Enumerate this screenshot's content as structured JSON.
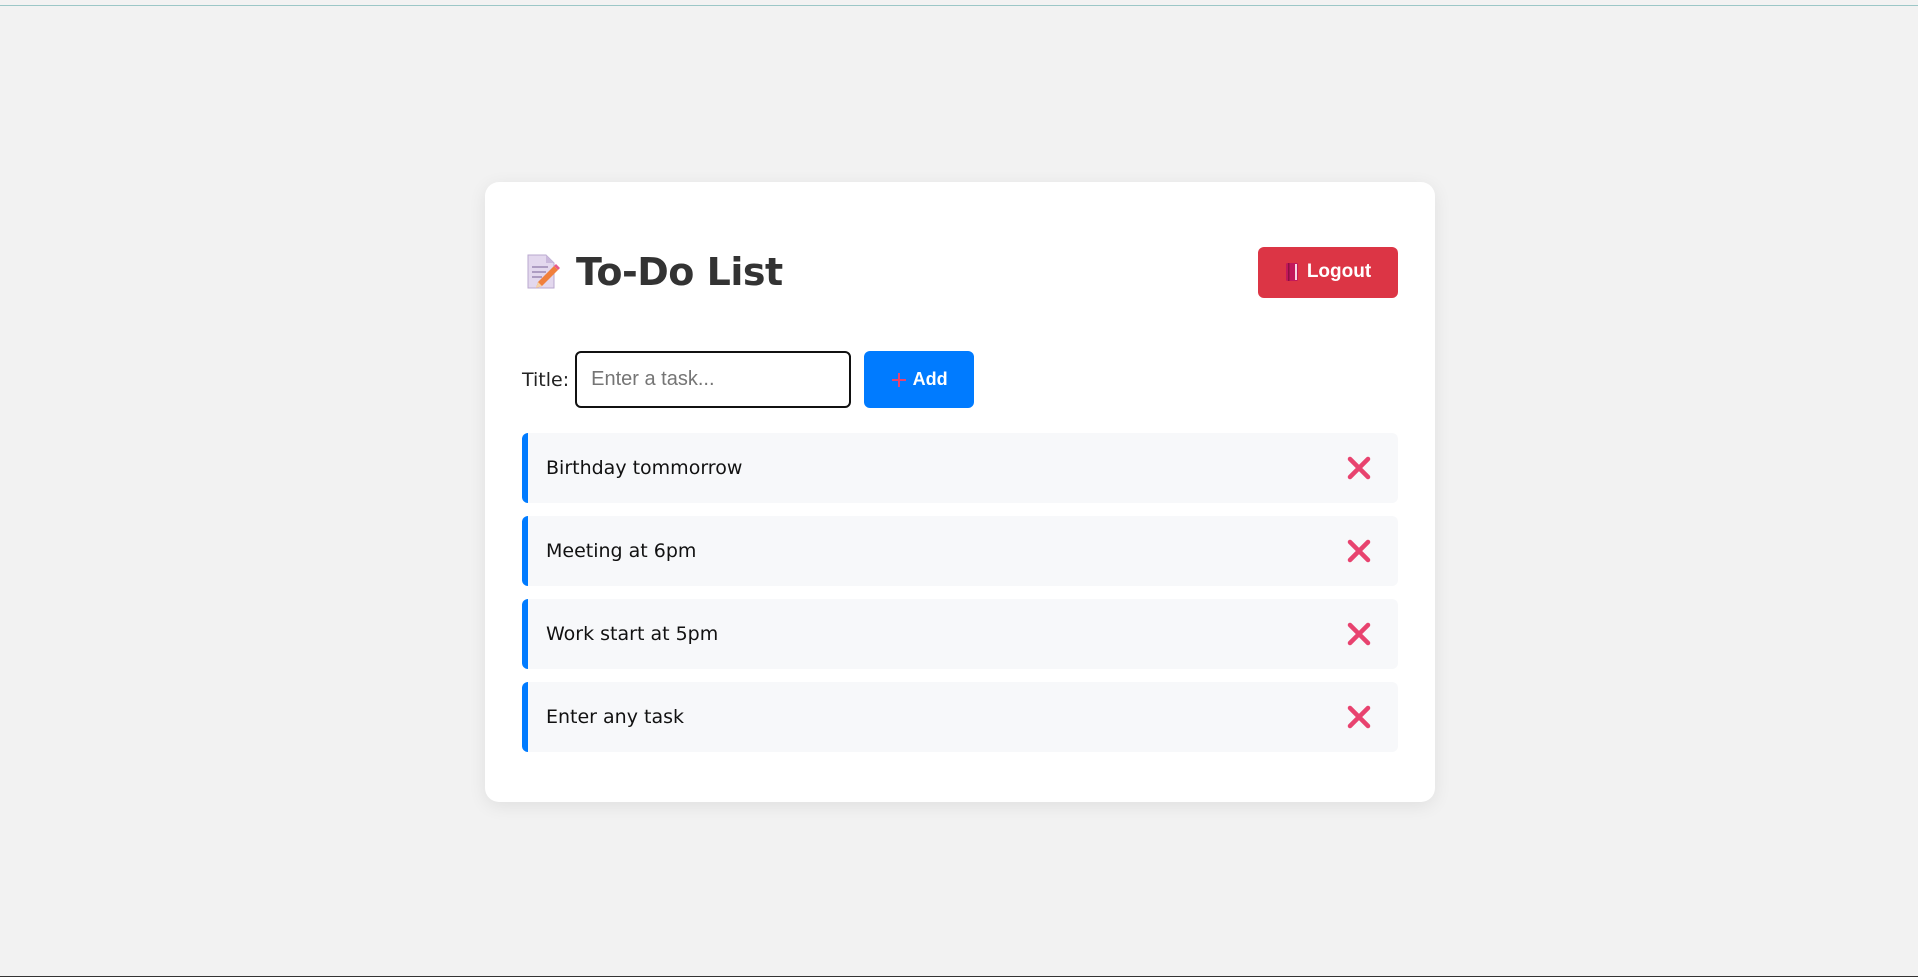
{
  "header": {
    "title": "To-Do List",
    "logout_label": "Logout"
  },
  "form": {
    "label": "Title:",
    "input_value": "",
    "input_placeholder": "Enter a task...",
    "add_label": "Add"
  },
  "tasks": [
    {
      "text": "Birthday tommorrow"
    },
    {
      "text": "Meeting at 6pm"
    },
    {
      "text": "Work start at 5pm"
    },
    {
      "text": "Enter any task"
    }
  ],
  "icons": {
    "title": "memo-icon",
    "logout": "book-icon",
    "add": "plus-icon",
    "delete": "cross-mark-icon"
  },
  "colors": {
    "background": "#f2f2f2",
    "card": "#ffffff",
    "logout": "#dc3545",
    "primary": "#007bff",
    "delete": "#e8436f",
    "task_bg": "#f7f8fa"
  }
}
